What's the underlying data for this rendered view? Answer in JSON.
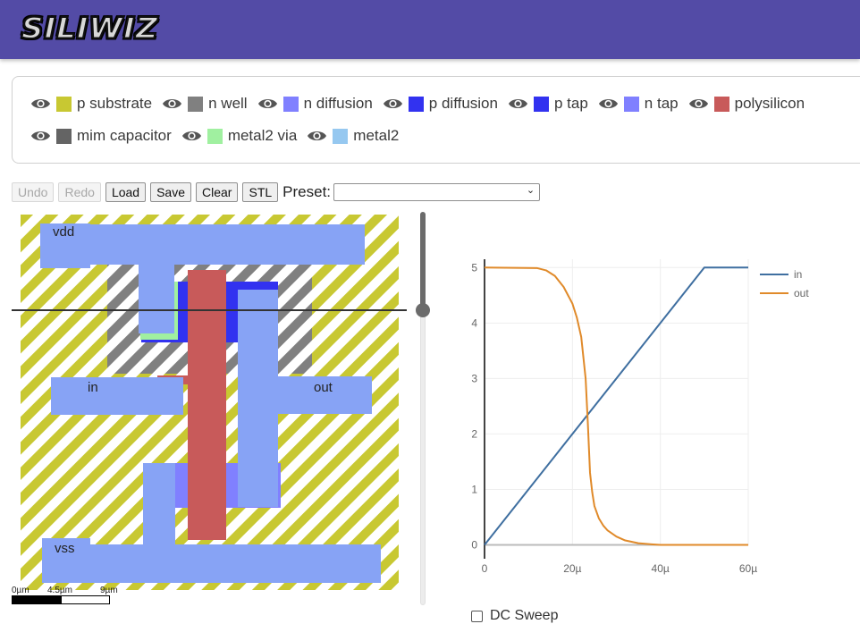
{
  "header": {
    "logo_text": "SILIWIZ",
    "background": "#534ba6"
  },
  "layers": {
    "rows": [
      [
        {
          "label": "p substrate",
          "color": "#c8c832",
          "visible": true
        },
        {
          "label": "n well",
          "color": "#808080",
          "visible": true
        },
        {
          "label": "n diffusion",
          "color": "#8080ff",
          "visible": true
        },
        {
          "label": "p diffusion",
          "color": "#3232f0",
          "visible": true
        },
        {
          "label": "p tap",
          "color": "#3232f0",
          "visible": true
        },
        {
          "label": "n tap",
          "color": "#8080ff",
          "visible": true
        },
        {
          "label": "polysilicon",
          "color": "#c85a5a",
          "visible": true
        }
      ],
      [
        {
          "label": "mim capacitor",
          "color": "#646464",
          "visible": true
        },
        {
          "label": "metal2 via",
          "color": "#a0f0a0",
          "visible": true
        },
        {
          "label": "metal2",
          "color": "#96c8f0",
          "visible": true
        }
      ]
    ]
  },
  "toolbar": {
    "undo": "Undo",
    "redo": "Redo",
    "load": "Load",
    "save": "Save",
    "clear": "Clear",
    "stl": "STL",
    "preset_label": "Preset:",
    "preset_value": ""
  },
  "layout": {
    "labels": {
      "vdd": "vdd",
      "in": "in",
      "out": "out",
      "vss": "vss"
    },
    "colors": {
      "substrate": "#c8c832",
      "nwell": "#808080",
      "metal1": "#87a3f5",
      "pdiff": "#3232f0",
      "ndiff": "#8080ff",
      "poly": "#c85a5a",
      "via": "#a0f0a0"
    }
  },
  "scale": {
    "labels": [
      "0µm",
      "4.5µm",
      "9µm"
    ]
  },
  "slider": {
    "value_fraction": 0.25
  },
  "dc_sweep": {
    "label": "DC Sweep",
    "checked": false
  },
  "chart_data": {
    "type": "line",
    "title": "",
    "xlabel": "",
    "ylabel": "",
    "xlim": [
      0,
      6e-05
    ],
    "ylim": [
      -0.25,
      5.15
    ],
    "x_ticks": [
      {
        "v": 0,
        "label": "0"
      },
      {
        "v": 2e-05,
        "label": "20µ"
      },
      {
        "v": 4e-05,
        "label": "40µ"
      },
      {
        "v": 6e-05,
        "label": "60µ"
      }
    ],
    "y_ticks": [
      {
        "v": 0,
        "label": "0"
      },
      {
        "v": 1,
        "label": "1"
      },
      {
        "v": 2,
        "label": "2"
      },
      {
        "v": 3,
        "label": "3"
      },
      {
        "v": 4,
        "label": "4"
      },
      {
        "v": 5,
        "label": "5"
      }
    ],
    "grid": true,
    "legend_position": "top-right",
    "series": [
      {
        "name": "in",
        "color": "#3f6fa0",
        "x": [
          0,
          5e-05,
          6e-05
        ],
        "y": [
          0,
          5,
          5
        ]
      },
      {
        "name": "out",
        "color": "#e08a2a",
        "x": [
          0,
          1.2e-05,
          1.4e-05,
          1.6e-05,
          1.8e-05,
          2e-05,
          2.1e-05,
          2.2e-05,
          2.3e-05,
          2.35e-05,
          2.4e-05,
          2.45e-05,
          2.5e-05,
          2.6e-05,
          2.7e-05,
          2.8e-05,
          3e-05,
          3.2e-05,
          3.5e-05,
          3.8e-05,
          4e-05,
          5e-05,
          6e-05
        ],
        "y": [
          5,
          4.99,
          4.95,
          4.85,
          4.65,
          4.35,
          4.1,
          3.75,
          3.0,
          2.2,
          1.3,
          0.95,
          0.7,
          0.48,
          0.35,
          0.26,
          0.15,
          0.08,
          0.03,
          0.01,
          0.0,
          0.0,
          0.0
        ]
      }
    ]
  }
}
